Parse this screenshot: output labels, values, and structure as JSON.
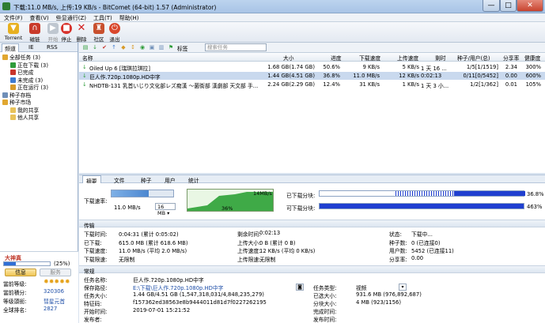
{
  "window": {
    "title": "下载:11.0 MB/s, 上传:19 KB/s - BitComet (64-bit) 1.57 (Administrator)",
    "min": "—",
    "max": "□",
    "close": "✕"
  },
  "menu": [
    "文件(F)",
    "查看(V)",
    "些显通行(Z)",
    "工具(T)",
    "帮助(H)"
  ],
  "toolbar": {
    "torrent": "Torrent",
    "magnet": "磁链",
    "start": "开始",
    "stop": "停止",
    "delete": "删除",
    "community": "社区",
    "exit": "退出"
  },
  "filter_toolbar": {
    "tag_label": "标签",
    "search_placeholder": "搜索任务"
  },
  "sidebar": {
    "tabs": [
      "频道",
      "IE",
      "RSS"
    ],
    "tree": [
      "全部任务 (3)",
      "正在下载 (3)",
      "已完成",
      "未完成 (3)",
      "正在运行 (3)",
      "种子存档",
      "种子市场",
      "我的共享",
      "他人共享"
    ],
    "footer": {
      "status": "大神真",
      "progress_pct": "(25%)",
      "progress_value": 25,
      "info_btn": "信息",
      "service_btn": "服务",
      "rank_label": "當前等级:",
      "score_label": "當前積分:",
      "score": "320306",
      "grade_label": "等级頭銜:",
      "grade": "彗星元首",
      "rank2_label": "全球排名:",
      "rank2": "2827"
    }
  },
  "columns": [
    "名称",
    "大小",
    "进度",
    "下载速度",
    "上传速度",
    "剩时",
    "种子/用户(总)",
    "分享率",
    "健康度"
  ],
  "tasks": [
    {
      "name": "Oiled Up 6 [瑞琪拉琪拉]",
      "size": "1.68 GB(1.74 GB)",
      "progress": "50.6%",
      "down": "9 KB/s",
      "up": "5 KB/s",
      "left": "1 天 16 ...",
      "peers": "1/5[1/1519]",
      "ratio": "2.34",
      "health": "300%",
      "sel": false
    },
    {
      "name": "巨人作.720p.1080p.HD中字",
      "size": "1.44 GB(4.51 GB)",
      "progress": "36.8%",
      "down": "11.0 MB/s",
      "up": "12 KB/s",
      "left": "0:02:13",
      "peers": "0/11[0/5452]",
      "ratio": "0.00",
      "health": "600%",
      "sel": true
    },
    {
      "name": "NHDTB-131 乳首いじり文化部レズ痴漢 ～菌街部 漢劇部 天文部 手...",
      "size": "2.24 GB(2.29 GB)",
      "progress": "12.4%",
      "down": "31 KB/s",
      "up": "1 KB/s",
      "left": "1 天 3 小...",
      "peers": "1/2[1/362]",
      "ratio": "0.01",
      "health": "105%",
      "sel": false
    }
  ],
  "detail_tabs": [
    "摘要",
    "文件",
    "种子",
    "用户",
    "统计"
  ],
  "speed": {
    "down_limit_label": "下载速率:",
    "down_speed": "11.0 MB/s",
    "limit_value": "16 MB",
    "graph_peak": "14MB/s",
    "graph_pct": "36%",
    "downloaded_label": "已下载分块:",
    "downloaded_pct": "36.8%",
    "available_label": "可下载分块:",
    "available_pct": "463%"
  },
  "transfer": {
    "title": "传输",
    "rows": [
      [
        "下载时间:",
        "0:04:31 (累计 0:05:02)",
        "剩余时间:",
        "0:02:13",
        "状态:",
        "下载中..."
      ],
      [
        "已下载:",
        "615.0 MB (累计 618.6 MB)",
        "上传大小:",
        "0 B (累计 0 B)",
        "种子数:",
        "0 (已连接0)"
      ],
      [
        "下载速度:",
        "11.0 MB/s (平均 2.0 MB/s)",
        "上传速度:",
        "12 KB/s (平均 0 KB/s)",
        "用户数:",
        "5452 (已连接11)"
      ],
      [
        "下载限速:",
        "无限制",
        "上传限速:",
        "无限制",
        "分享率:",
        "0.00"
      ]
    ]
  },
  "general": {
    "title": "常规",
    "rows": [
      [
        "任务名称:",
        "巨人作.720p.1080p.HD中字",
        "",
        ""
      ],
      [
        "保存路径:",
        "E:\\下载\\巨人作.720p.1080p.HD中字",
        "任务类型:",
        "视频"
      ],
      [
        "任务大小:",
        "1.44 GB/4.51 GB (1,547,318,031/4,848,235,279)",
        "已选大小:",
        "931.6 MB (976,892,687)"
      ],
      [
        "特征码:",
        "f157362ed38563e8b9444011d81d7f0227262195",
        "分块大小:",
        "4 MB (923/1156)"
      ],
      [
        "开始时间:",
        "2019-07-01 15:21:52",
        "完成时间:",
        ""
      ],
      [
        "发布者:",
        "",
        "发布时间:",
        ""
      ]
    ]
  },
  "colors": {
    "accent": "#2f6fd6",
    "grid_green": "#2da13a",
    "bar_blue": "#1f3fd0"
  }
}
